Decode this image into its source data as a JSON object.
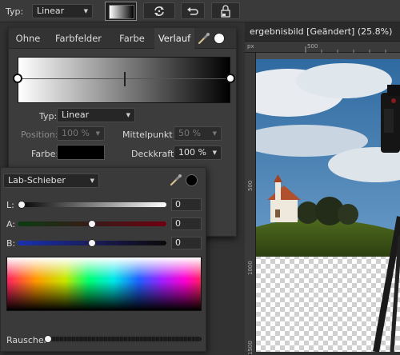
{
  "optionsbar": {
    "typ_label": "Typ:",
    "typ_value": "Linear"
  },
  "document": {
    "title": "ergebnisbild [Geändert] (25.8%)",
    "ruler_unit": "px",
    "ruler_top_marks": [
      "500"
    ],
    "ruler_left_marks": [
      "500",
      "1000",
      "1500"
    ]
  },
  "popup": {
    "tabs": [
      "Ohne",
      "Farbfelder",
      "Farbe",
      "Verlauf"
    ],
    "active_tab": "Verlauf",
    "gradient": {
      "start_color": "#ffffff",
      "end_color": "#000000",
      "midpoint_percent": 50
    },
    "typ_label": "Typ:",
    "typ_value": "Linear",
    "position_label": "Position:",
    "position_value": "100 %",
    "mittelpunkt_label": "Mittelpunkt:",
    "mittelpunkt_value": "50 %",
    "farbe_label": "Farbe:",
    "farbe_swatch": "#000000",
    "deckkraft_label": "Deckkraft:",
    "deckkraft_value": "100 %"
  },
  "colorpanel": {
    "mode": "Lab-Schieber",
    "L": {
      "label": "L:",
      "value": "0"
    },
    "A": {
      "label": "A:",
      "value": "0"
    },
    "B": {
      "label": "B:",
      "value": "0"
    },
    "rauschen_label": "Rauschen"
  }
}
